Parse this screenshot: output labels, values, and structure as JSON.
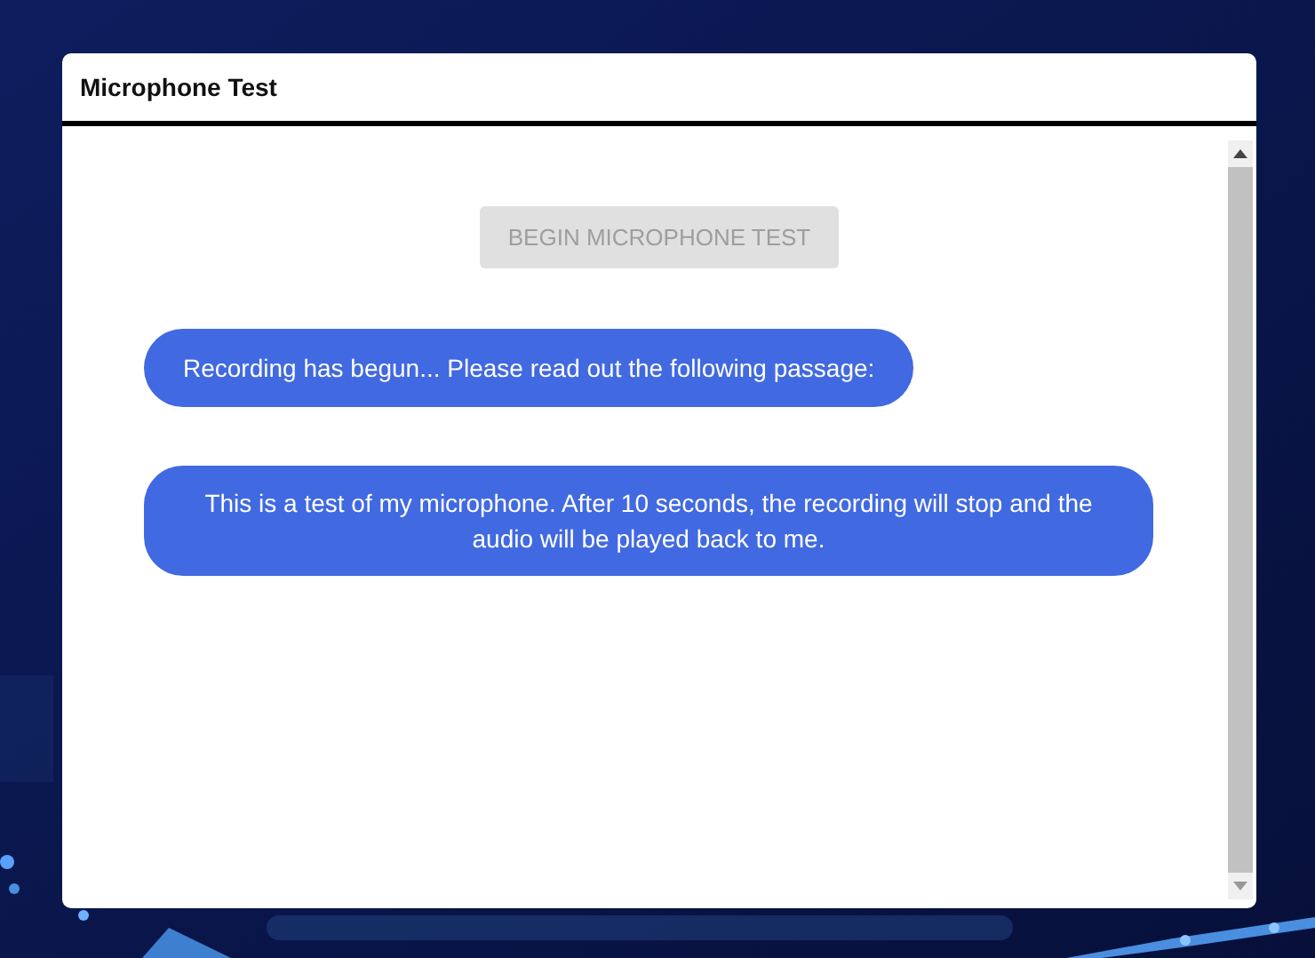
{
  "window": {
    "title": "Microphone Test"
  },
  "button": {
    "label": "BEGIN MICROPHONE TEST",
    "disabled": true
  },
  "messages": [
    {
      "text": "Recording has begun... Please read out the following passage:"
    },
    {
      "text": "This is a test of my microphone. After 10 seconds, the recording will stop and the audio will be played back to me."
    }
  ]
}
